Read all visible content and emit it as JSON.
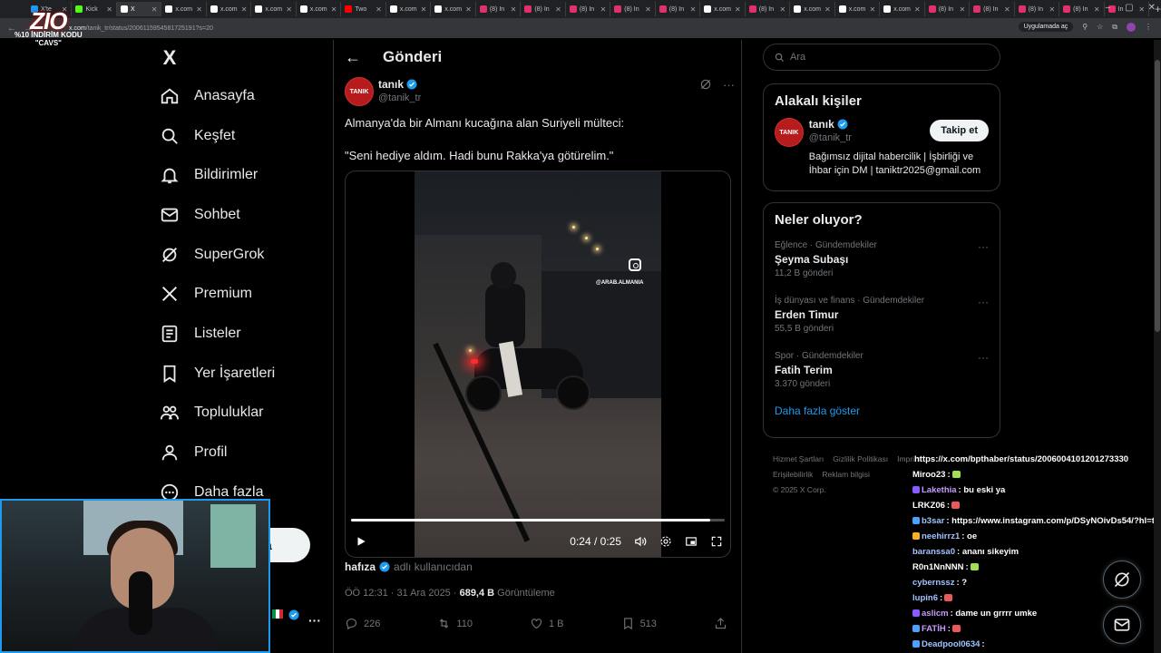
{
  "browser": {
    "tabs": [
      {
        "label": "X'te",
        "color": "#1d9bf0"
      },
      {
        "label": "Kick",
        "color": "#53fc18"
      },
      {
        "label": "X",
        "color": "#ffffff",
        "active": true
      },
      {
        "label": "x.com",
        "color": "#ffffff"
      },
      {
        "label": "x.com",
        "color": "#ffffff"
      },
      {
        "label": "x.com",
        "color": "#ffffff"
      },
      {
        "label": "x.com",
        "color": "#ffffff"
      },
      {
        "label": "Two",
        "color": "#ff0000"
      },
      {
        "label": "x.com",
        "color": "#ffffff"
      },
      {
        "label": "x.com",
        "color": "#ffffff"
      },
      {
        "label": "(8) In",
        "color": "#e1306c"
      },
      {
        "label": "(8) In",
        "color": "#e1306c"
      },
      {
        "label": "(8) In",
        "color": "#e1306c"
      },
      {
        "label": "(8) In",
        "color": "#e1306c"
      },
      {
        "label": "(8) In",
        "color": "#e1306c"
      },
      {
        "label": "x.com",
        "color": "#ffffff"
      },
      {
        "label": "(8) In",
        "color": "#e1306c"
      },
      {
        "label": "x.com",
        "color": "#ffffff"
      },
      {
        "label": "x.com",
        "color": "#ffffff"
      },
      {
        "label": "x.com",
        "color": "#ffffff"
      },
      {
        "label": "(8) In",
        "color": "#e1306c"
      },
      {
        "label": "(8) In",
        "color": "#e1306c"
      },
      {
        "label": "(8) In",
        "color": "#e1306c"
      },
      {
        "label": "(8) In",
        "color": "#e1306c"
      },
      {
        "label": "In",
        "color": "#e1306c"
      }
    ],
    "url_host": "x.com",
    "url_path": "/tanik_tr/status/2006115954581725191?s=20",
    "open_in_app": "Uygulamada aç"
  },
  "promo": {
    "logo": "ZIO",
    "line1": "%10 İNDİRİM KODU",
    "line2": "\"CAVS\""
  },
  "nav": {
    "logo": "X",
    "items": [
      {
        "label": "Anasayfa",
        "icon": "home-icon"
      },
      {
        "label": "Keşfet",
        "icon": "search-icon"
      },
      {
        "label": "Bildirimler",
        "icon": "bell-icon"
      },
      {
        "label": "Sohbet",
        "icon": "mail-icon"
      },
      {
        "label": "SuperGrok",
        "icon": "grok-icon"
      },
      {
        "label": "Premium",
        "icon": "x-icon"
      },
      {
        "label": "Listeler",
        "icon": "list-icon"
      },
      {
        "label": "Yer İşaretleri",
        "icon": "bookmark-icon"
      },
      {
        "label": "Topluluklar",
        "icon": "people-icon"
      },
      {
        "label": "Profil",
        "icon": "person-icon"
      },
      {
        "label": "Daha fazla",
        "icon": "more-circle-icon"
      }
    ],
    "post_button_partial": "a",
    "account_more": "···"
  },
  "post": {
    "header_title": "Gönderi",
    "author_name": "tanık",
    "author_handle": "@tanik_tr",
    "avatar_text": "TANIK",
    "text_line1": "Almanya'da bir Almanı kucağına alan Suriyeli mülteci:",
    "text_line2": "\"Seni hediye aldım. Hadi bunu Rakka'ya götürelim.\"",
    "video": {
      "watermark": "@ARAB.ALMANIA",
      "time": "0:24 / 0:25",
      "progress": 0.96
    },
    "retweeted_by": "hafıza",
    "retweeted_suffix": "adlı kullanıcıdan",
    "timestamp": "ÖÖ 12:31 · 31 Ara 2025 · ",
    "views": "689,4 B",
    "views_label": " Görüntüleme",
    "replies": "226",
    "reposts": "110",
    "likes": "1 B",
    "bookmarks": "513"
  },
  "right": {
    "search_placeholder": "Ara",
    "related_title": "Alakalı kişiler",
    "related": {
      "name": "tanık",
      "handle": "@tanik_tr",
      "bio": "Bağımsız dijital habercilik | İşbirliği ve İhbar için DM | taniktr2025@gmail.com",
      "follow": "Takip et"
    },
    "trends_title": "Neler oluyor?",
    "trends": [
      {
        "category": "Eğlence · Gündemdekiler",
        "title": "Şeyma Subaşı",
        "count": "11,2 B gönderi"
      },
      {
        "category": "İş dünyası ve finans · Gündemdekiler",
        "title": "Erden Timur",
        "count": "55,5 B gönderi"
      },
      {
        "category": "Spor · Gündemdekiler",
        "title": "Fatih Terim",
        "count": "3.370 gönderi"
      }
    ],
    "show_more": "Daha fazla göster",
    "footer": [
      "Hizmet Şartları",
      "Gizlilik Politikası",
      "Imprint",
      "Erişilebilirlik",
      "Reklam bilgisi",
      "© 2025 X Corp."
    ]
  },
  "chat": [
    {
      "user": "",
      "msg": "https://x.com/bpthaber/status/2006004101201273330",
      "color": "#ffffff"
    },
    {
      "user": "Miroo23",
      "msg": ":",
      "color": "#ffffff"
    },
    {
      "user": "Lakethia",
      "msg": ": bu eski ya",
      "color": "#c79bff"
    },
    {
      "user": "LRKZ06",
      "msg": ":",
      "color": "#ffffff"
    },
    {
      "user": "b3sar",
      "msg": ": https://www.instagram.com/p/DSyNOivDs54/?hl=tr",
      "color": "#a0c4ff"
    },
    {
      "user": "neehirrz1",
      "msg": ": oe",
      "color": "#a0c4ff"
    },
    {
      "user": "baranssa0",
      "msg": ": ananı sikeyim",
      "color": "#a0c4ff"
    },
    {
      "user": "R0n1NnNNN",
      "msg": ":",
      "color": "#ffffff"
    },
    {
      "user": "cybernssz",
      "msg": ": ?",
      "color": "#a0c4ff"
    },
    {
      "user": "lupin6",
      "msg": ":",
      "color": "#a0c4ff"
    },
    {
      "user": "aslicm",
      "msg": ": dame un grrrr umke",
      "color": "#c79bff"
    },
    {
      "user": "FATİH",
      "msg": ":",
      "color": "#c79bff"
    },
    {
      "user": "Deadpool0634",
      "msg": ":",
      "color": "#a0c4ff"
    }
  ]
}
